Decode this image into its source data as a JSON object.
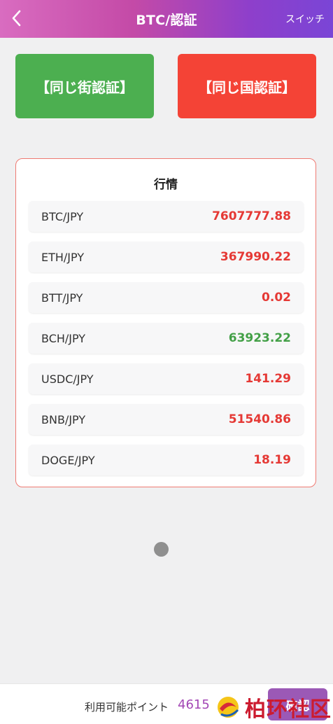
{
  "header": {
    "title": "BTC/認証",
    "switch_label": "スイッチ"
  },
  "actions": {
    "street_verify_label": "【同じ街認証】",
    "country_verify_label": "【同じ国認証】"
  },
  "market": {
    "title": "行情",
    "rows": [
      {
        "pair": "BTC/JPY",
        "price": "7607777.88",
        "trend": "up"
      },
      {
        "pair": "ETH/JPY",
        "price": "367990.22",
        "trend": "up"
      },
      {
        "pair": "BTT/JPY",
        "price": "0.02",
        "trend": "up"
      },
      {
        "pair": "BCH/JPY",
        "price": "63923.22",
        "trend": "down"
      },
      {
        "pair": "USDC/JPY",
        "price": "141.29",
        "trend": "up"
      },
      {
        "pair": "BNB/JPY",
        "price": "51540.86",
        "trend": "up"
      },
      {
        "pair": "DOGE/JPY",
        "price": "18.19",
        "trend": "up"
      }
    ]
  },
  "footer": {
    "points_label": "利用可能ポイント",
    "points_value": "4615",
    "confirm_label": "確認"
  },
  "watermark": {
    "text": "柏环社区"
  },
  "colors": {
    "green": "#4caf50",
    "red": "#f44336",
    "price_up": "#e53935",
    "price_down": "#43a047",
    "accent": "#9b59b6"
  },
  "icons": {
    "back": "chevron-left-icon",
    "loading": "loading-dot-icon"
  }
}
